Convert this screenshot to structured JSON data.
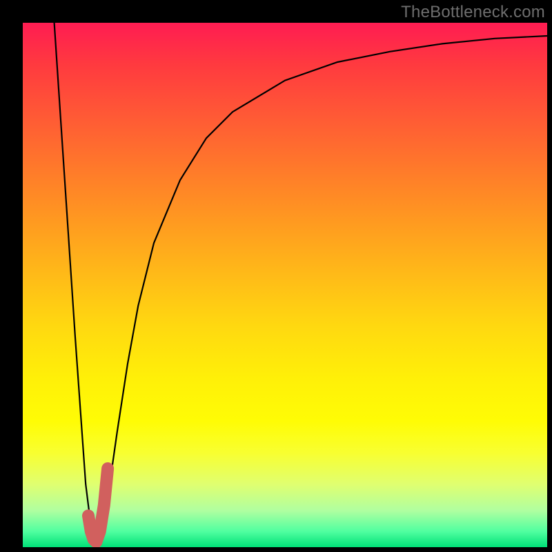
{
  "watermark": "TheBottleneck.com",
  "chart_data": {
    "type": "line",
    "title": "",
    "xlabel": "",
    "ylabel": "",
    "xlim": [
      0,
      100
    ],
    "ylim": [
      0,
      100
    ],
    "grid": false,
    "legend": false,
    "series": [
      {
        "name": "bottleneck-percentage",
        "x": [
          6,
          8,
          10,
          12,
          13,
          14,
          15,
          16,
          18,
          20,
          22,
          25,
          30,
          35,
          40,
          50,
          60,
          70,
          80,
          90,
          100
        ],
        "y": [
          100,
          70,
          40,
          12,
          4,
          1,
          3,
          8,
          22,
          35,
          46,
          58,
          70,
          78,
          83,
          89,
          92.5,
          94.5,
          96,
          97,
          97.5
        ]
      }
    ],
    "highlight": {
      "name": "optimal-region",
      "color": "#d1605e",
      "x": [
        12.5,
        13,
        13.5,
        14,
        14.7,
        15.5,
        16.2
      ],
      "y": [
        6,
        3,
        1.5,
        1,
        3,
        8,
        15
      ]
    }
  }
}
